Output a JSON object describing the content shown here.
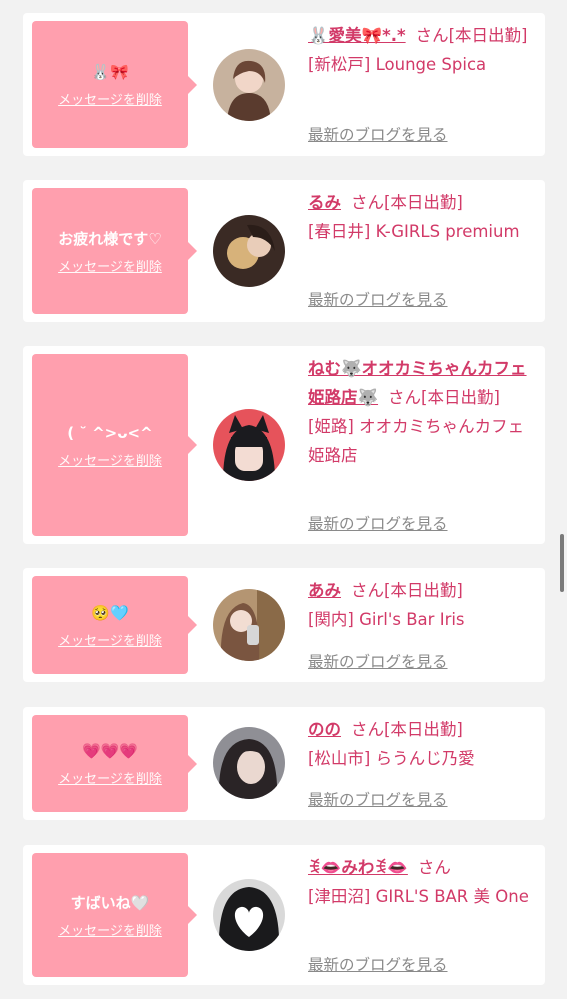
{
  "delete_label": "メッセージを削除",
  "blog_label": "最新のブログを見る",
  "san": "さん",
  "cards": [
    {
      "message": "🐰🎀",
      "name": "🐰愛美🎀*.*",
      "status": "[本日出勤]",
      "shop_area": "[新松戸]",
      "shop_name": "Lounge Spica"
    },
    {
      "message": "お疲れ様です♡",
      "name": "るみ",
      "status": "[本日出勤]",
      "shop_area": "[春日井]",
      "shop_name": "K-GIRLS premium"
    },
    {
      "message": "( ˘ ^>ᴗ<^",
      "name": "ねむ🐺オオカミちゃんカフェ姫路店🐺",
      "status": "[本日出勤]",
      "shop_area": "[姫路]",
      "shop_name": "オオカミちゃんカフェ姫路店"
    },
    {
      "message": "🥺🩵",
      "name": "あみ",
      "status": "[本日出勤]",
      "shop_area": "[関内]",
      "shop_name": "Girl's Bar Iris"
    },
    {
      "message": "💗💗💗",
      "name": "のの",
      "status": "[本日出勤]",
      "shop_area": "[松山市]",
      "shop_name": "らうんじ乃愛"
    },
    {
      "message": "すばいね🤍",
      "name": "ꉂ👄みわꉂ👄",
      "status": "",
      "shop_area": "[津田沼]",
      "shop_name": "GIRL'S BAR 美 One"
    }
  ],
  "colors": {
    "accent_pink": "#ff9fae",
    "name_pink": "#d23a68",
    "blog_gray": "#8a8a8a"
  }
}
